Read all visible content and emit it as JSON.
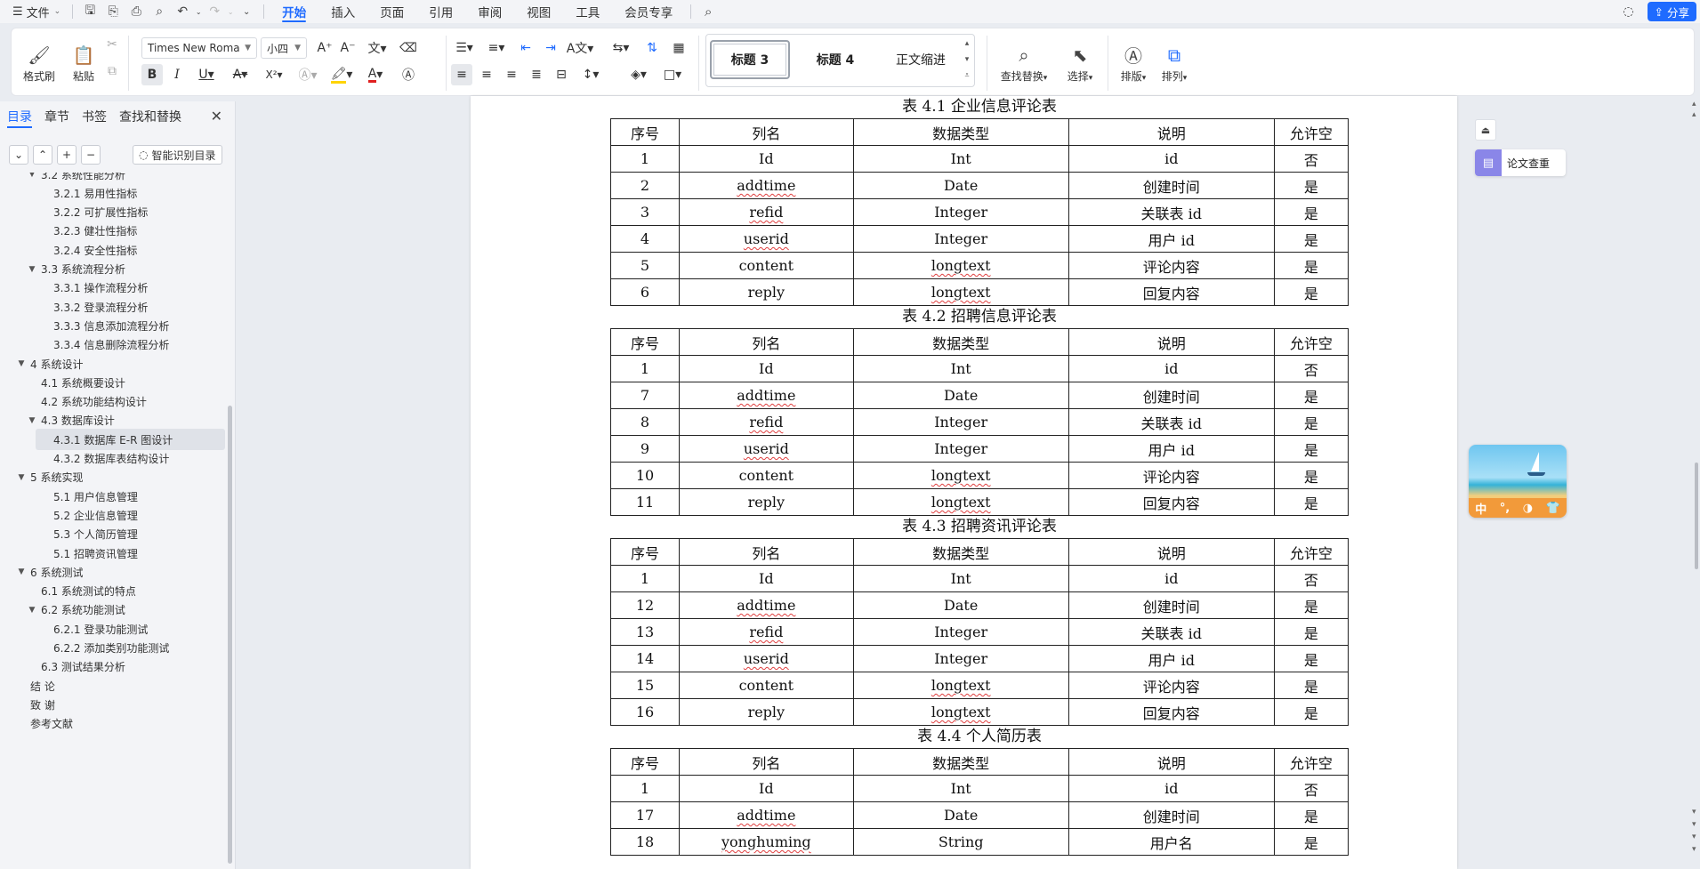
{
  "menubar": {
    "file": "文件",
    "tabs": [
      "开始",
      "插入",
      "页面",
      "引用",
      "审阅",
      "视图",
      "工具",
      "会员专享"
    ],
    "active_tab": "开始",
    "share": "分享"
  },
  "ribbon": {
    "format_painter": "格式刷",
    "paste": "粘贴",
    "font_name": "Times New Roma",
    "font_size": "小四",
    "styles": [
      "标题 3",
      "标题 4",
      "正文缩进"
    ],
    "find_replace": "查找替换",
    "select": "选择",
    "layout": "排版",
    "arrange": "排列",
    "bold": "B",
    "italic": "I",
    "underline": "U",
    "strike": "A",
    "superscript": "X²",
    "font_color": "A"
  },
  "nav": {
    "tabs": [
      "目录",
      "章节",
      "书签",
      "查找和替换"
    ],
    "active_tab": "目录",
    "smart_toc": "智能识别目录",
    "items": [
      {
        "level": 2,
        "label": "3.2  系统性能分析",
        "expanded": true,
        "cut": true
      },
      {
        "level": 3,
        "label": "3.2.1  易用性指标"
      },
      {
        "level": 3,
        "label": "3.2.2  可扩展性指标"
      },
      {
        "level": 3,
        "label": "3.2.3  健壮性指标"
      },
      {
        "level": 3,
        "label": "3.2.4  安全性指标"
      },
      {
        "level": 2,
        "label": "3.3  系统流程分析",
        "expanded": true
      },
      {
        "level": 3,
        "label": "3.3.1  操作流程分析"
      },
      {
        "level": 3,
        "label": "3.3.2  登录流程分析"
      },
      {
        "level": 3,
        "label": "3.3.3  信息添加流程分析"
      },
      {
        "level": 3,
        "label": "3.3.4  信息删除流程分析"
      },
      {
        "level": 1,
        "label": "4  系统设计",
        "expanded": true
      },
      {
        "level": 2,
        "label": "4.1  系统概要设计"
      },
      {
        "level": 2,
        "label": "4.2  系统功能结构设计"
      },
      {
        "level": 2,
        "label": "4.3  数据库设计",
        "expanded": true
      },
      {
        "level": 3,
        "label": "4.3.1  数据库 E-R 图设计",
        "active": true
      },
      {
        "level": 3,
        "label": "4.3.2  数据库表结构设计"
      },
      {
        "level": 1,
        "label": "5  系统实现",
        "expanded": true
      },
      {
        "level": 3,
        "label": "5.1 用户信息管理"
      },
      {
        "level": 3,
        "label": "5.2  企业信息管理"
      },
      {
        "level": 3,
        "label": "5.3 个人简历管理"
      },
      {
        "level": 3,
        "label": "5.1 招聘资讯管理"
      },
      {
        "level": 1,
        "label": "6  系统测试",
        "expanded": true
      },
      {
        "level": 2,
        "label": "6.1  系统测试的特点"
      },
      {
        "level": 2,
        "label": "6.2  系统功能测试",
        "expanded": true
      },
      {
        "level": 3,
        "label": "6.2.1  登录功能测试"
      },
      {
        "level": 3,
        "label": "6.2.2  添加类别功能测试"
      },
      {
        "level": 2,
        "label": "6.3  测试结果分析"
      },
      {
        "level": 1,
        "label": "结    论",
        "noarrow": true
      },
      {
        "level": 1,
        "label": "致    谢",
        "noarrow": true
      },
      {
        "level": 1,
        "label": "参考文献",
        "noarrow": true
      }
    ]
  },
  "document": {
    "headers": [
      "序号",
      "列名",
      "数据类型",
      "说明",
      "允许空"
    ],
    "tables": [
      {
        "caption": "表 4.1 企业信息评论表",
        "rows": [
          [
            "1",
            "Id",
            "Int",
            "id",
            "否"
          ],
          [
            "2",
            "addtime",
            "Date",
            "创建时间",
            "是"
          ],
          [
            "3",
            "refid",
            "Integer",
            "关联表 id",
            "是"
          ],
          [
            "4",
            "userid",
            "Integer",
            "用户 id",
            "是"
          ],
          [
            "5",
            "content",
            "longtext",
            "评论内容",
            "是"
          ],
          [
            "6",
            "reply",
            "longtext",
            "回复内容",
            "是"
          ]
        ]
      },
      {
        "caption": "表 4.2 招聘信息评论表",
        "rows": [
          [
            "1",
            "Id",
            "Int",
            "id",
            "否"
          ],
          [
            "7",
            "addtime",
            "Date",
            "创建时间",
            "是"
          ],
          [
            "8",
            "refid",
            "Integer",
            "关联表 id",
            "是"
          ],
          [
            "9",
            "userid",
            "Integer",
            "用户 id",
            "是"
          ],
          [
            "10",
            "content",
            "longtext",
            "评论内容",
            "是"
          ],
          [
            "11",
            "reply",
            "longtext",
            "回复内容",
            "是"
          ]
        ]
      },
      {
        "caption": "表 4.3 招聘资讯评论表",
        "rows": [
          [
            "1",
            "Id",
            "Int",
            "id",
            "否"
          ],
          [
            "12",
            "addtime",
            "Date",
            "创建时间",
            "是"
          ],
          [
            "13",
            "refid",
            "Integer",
            "关联表 id",
            "是"
          ],
          [
            "14",
            "userid",
            "Integer",
            "用户 id",
            "是"
          ],
          [
            "15",
            "content",
            "longtext",
            "评论内容",
            "是"
          ],
          [
            "16",
            "reply",
            "longtext",
            "回复内容",
            "是"
          ]
        ]
      },
      {
        "caption": "表 4.4 个人简历表",
        "rows": [
          [
            "1",
            "Id",
            "Int",
            "id",
            "否"
          ],
          [
            "17",
            "addtime",
            "Date",
            "创建时间",
            "是"
          ],
          [
            "18",
            "yonghuming",
            "String",
            "用户名",
            "是"
          ]
        ]
      }
    ],
    "spellcheck_words": [
      "addtime",
      "refid",
      "userid",
      "longtext",
      "yonghuming"
    ]
  },
  "right_panel": {
    "paper_check": "论文查重",
    "promo_chars": [
      "中",
      "°,",
      "◑",
      "👕"
    ]
  },
  "colors": {
    "accent": "#1f6bff",
    "paper_check_icon": "#8a86e8",
    "promo_bar": "#f29a3a"
  }
}
